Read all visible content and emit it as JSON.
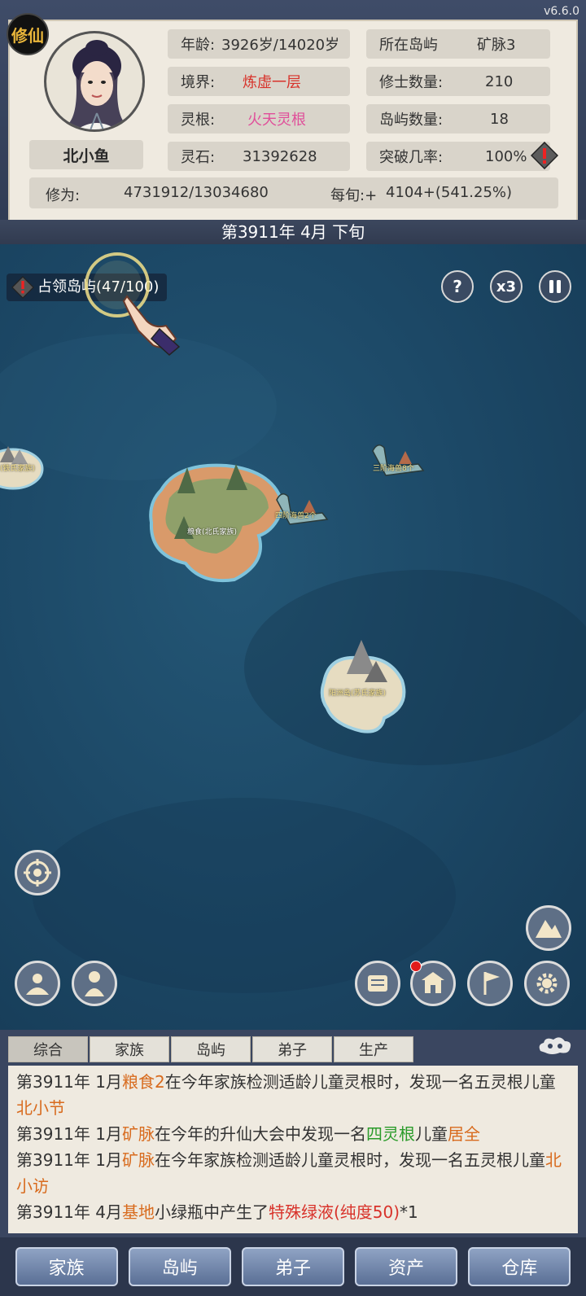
{
  "version": "v6.6.0",
  "badge": "修仙",
  "player": {
    "name": "北小鱼"
  },
  "stats": {
    "age_label": "年龄:",
    "age_value": "3926岁/14020岁",
    "realm_label": "境界:",
    "realm_value": "炼虚一层",
    "root_label": "灵根:",
    "root_value": "火天灵根",
    "stone_label": "灵石:",
    "stone_value": "31392628",
    "island_label": "所在岛屿",
    "island_value": "矿脉3",
    "cultivator_label": "修士数量:",
    "cultivator_value": "210",
    "island_count_label": "岛屿数量:",
    "island_count_value": "18",
    "breakthrough_label": "突破几率:",
    "breakthrough_value": "100%",
    "cultivation_label": "修为:",
    "cultivation_value": "4731912/13034680",
    "per_xun_label": "每旬:+",
    "per_xun_value": "4104+(541.25%)"
  },
  "date": "第3911年 4月 下旬",
  "map": {
    "occupy_text": "占领岛屿(47/100)",
    "help": "?",
    "speed": "x3",
    "labels": {
      "left_island": "(铁氏家族)",
      "main_island": "粮食(北氏家族)",
      "beast1": "四阶海兽2个",
      "beast2": "三阶海兽8个",
      "south_island": "阳洲岛(苏氏家族)"
    }
  },
  "log": {
    "tabs": [
      "综合",
      "家族",
      "岛屿",
      "弟子",
      "生产"
    ],
    "lines": [
      {
        "a": "第3911年 1月",
        "b": "粮食2",
        "c": "在今年家族检测适龄儿童灵根时，发现一名五灵根儿童",
        "d": "北小节"
      },
      {
        "a": "第3911年 1月",
        "b": "矿脉",
        "c": "在今年的升仙大会中发现一名",
        "d": "四灵根",
        "e": "儿童",
        "f": "居全"
      },
      {
        "a": "第3911年 1月",
        "b": "矿脉",
        "c": "在今年家族检测适龄儿童灵根时，发现一名五灵根儿童",
        "d": "北小访"
      },
      {
        "a": "第3911年 4月",
        "b": "基地",
        "c": "小绿瓶中产生了",
        "d": "特殊绿液(纯度50)",
        "e": "*1"
      }
    ]
  },
  "nav": [
    "家族",
    "岛屿",
    "弟子",
    "资产",
    "仓库"
  ],
  "colors": {
    "realm": "#d8322a",
    "root": "#e04f9a",
    "map_sea": "#1c4866"
  }
}
